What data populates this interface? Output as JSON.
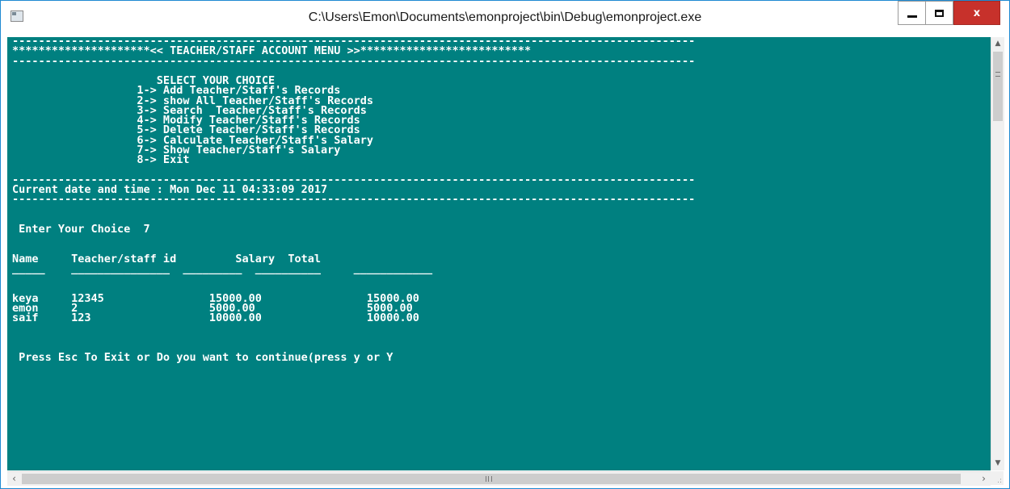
{
  "window": {
    "title": "C:\\Users\\Emon\\Documents\\emonproject\\bin\\Debug\\emonproject.exe",
    "close_glyph": "x"
  },
  "console": {
    "lines": [
      "--------------------------------------------------------------------------------------------------------",
      "*********************<< TEACHER/STAFF ACCOUNT MENU >>**************************",
      "--------------------------------------------------------------------------------------------------------",
      "",
      "                      SELECT YOUR CHOICE",
      "                   1-> Add Teacher/Staff's Records",
      "                   2-> show All Teacher/Staff's Records",
      "                   3-> Search  Teacher/Staff's Records",
      "                   4-> Modify Teacher/Staff's Records",
      "                   5-> Delete Teacher/Staff's Records",
      "                   6-> Calculate Teacher/Staff's Salary",
      "                   7-> Show Teacher/Staff's Salary",
      "                   8-> Exit",
      "",
      "--------------------------------------------------------------------------------------------------------",
      "Current date and time : Mon Dec 11 04:33:09 2017",
      "--------------------------------------------------------------------------------------------------------",
      "",
      "",
      " Enter Your Choice  7",
      "",
      "",
      "Name     Teacher/staff id         Salary  Total",
      "_____    _______________  _________  __________     ____________",
      "",
      "",
      "keya     12345                15000.00                15000.00",
      "emon     2                    5000.00                 5000.00",
      "saif     123                  10000.00                10000.00",
      "",
      "",
      "",
      " Press Esc To Exit or Do you want to continue(press y or Y"
    ]
  },
  "colors": {
    "console_background": "#008080",
    "console_text": "#ffffff",
    "close_button": "#c7312b",
    "window_border": "#1f8ad2"
  }
}
